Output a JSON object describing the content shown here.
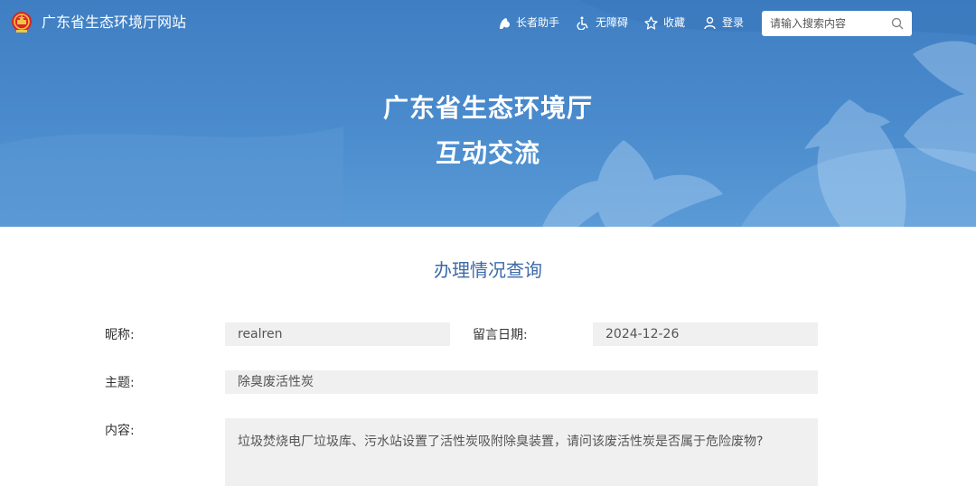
{
  "header": {
    "site_name": "广东省生态环境厅网站",
    "tools": [
      {
        "label": "长者助手",
        "icon": "elderly-assist-icon"
      },
      {
        "label": "无障碍",
        "icon": "wheelchair-icon"
      },
      {
        "label": "收藏",
        "icon": "star-icon"
      },
      {
        "label": "登录",
        "icon": "user-icon"
      }
    ],
    "search": {
      "placeholder": "请输入搜索内容",
      "value": ""
    }
  },
  "banner": {
    "title_line1": "广东省生态环境厅",
    "title_line2": "互动交流"
  },
  "main": {
    "section_title": "办理情况查询",
    "form": {
      "nickname_label": "昵称:",
      "nickname_value": "realren",
      "date_label": "留言日期:",
      "date_value": "2024-12-26",
      "subject_label": "主题:",
      "subject_value": "除臭废活性炭",
      "content_label": "内容:",
      "content_value": "垃圾焚烧电厂垃圾库、污水站设置了活性炭吸附除臭装置，请问该废活性炭是否属于危险废物?"
    }
  },
  "colors": {
    "banner_blue": "#4a8bcd",
    "title_blue": "#3d6aa8",
    "field_bg": "#f0f0f0"
  }
}
